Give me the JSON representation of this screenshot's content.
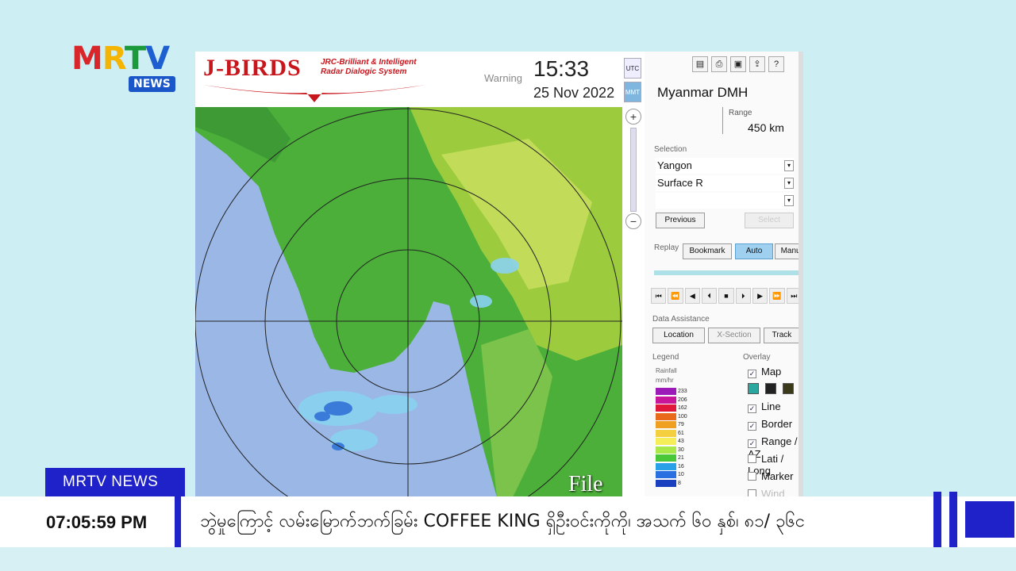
{
  "logo": {
    "mrtv": "MRTV",
    "news": "NEWS"
  },
  "app": {
    "brand": "J-BIRDS",
    "brand_sub_1": "JRC-Brilliant & Intelligent",
    "brand_sub_2": "Radar Dialogic System",
    "warning": "Warning",
    "time": "15:33",
    "date": "25 Nov 2022",
    "tz_utc": "UTC",
    "tz_mmt": "MMT",
    "file_label": "File"
  },
  "panel": {
    "site": "Myanmar DMH",
    "range_label": "Range",
    "range_value": "450 km",
    "selection_label": "Selection",
    "selection_1": "Yangon",
    "selection_2": "Surface R",
    "previous": "Previous",
    "select": "Select",
    "replay_label": "Replay",
    "bookmark": "Bookmark",
    "auto": "Auto",
    "manual": "Manual",
    "data_assistance": "Data Assistance",
    "location": "Location",
    "xsection": "X-Section",
    "track": "Track",
    "legend": "Legend",
    "overlay": "Overlay",
    "legend_title": "Rainfall",
    "legend_unit": "mm/hr",
    "legend_values": [
      "233",
      "206",
      "162",
      "100",
      "79",
      "61",
      "43",
      "30",
      "21",
      "16",
      "10",
      "8"
    ],
    "overlay_items": [
      "Map",
      "Line",
      "Border",
      "Range / AZ",
      "Lati / Long",
      "Marker",
      "Wind"
    ]
  },
  "ticker": {
    "tag": "MRTV NEWS",
    "time": "07:05:59  PM",
    "text": "ဘွဲမှုကြောင့်  လမ်းမြောက်ဘက်ခြမ်း COFFEE KING ရှိဦးဝင်းကိုကို၊ အသက် ၆၀ နှစ်၊ ၈၁/ ၃၆င"
  },
  "colors": {
    "brand_red": "#c8161d",
    "ticker_blue": "#1e22c8",
    "auto_active": "#9fd0f0"
  }
}
